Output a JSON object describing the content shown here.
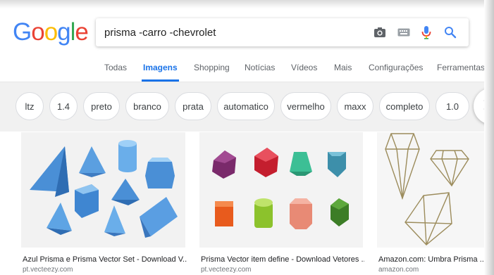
{
  "logo": {
    "letters": [
      "G",
      "o",
      "o",
      "g",
      "l",
      "e"
    ],
    "colors": [
      "#4285F4",
      "#EA4335",
      "#FBBC05",
      "#4285F4",
      "#34A853",
      "#EA4335"
    ]
  },
  "search": {
    "query": "prisma -carro -chevrolet",
    "icons": [
      "camera-icon",
      "keyboard-icon",
      "microphone-icon",
      "search-icon"
    ]
  },
  "tabs": [
    {
      "label": "Todas",
      "active": false
    },
    {
      "label": "Imagens",
      "active": true
    },
    {
      "label": "Shopping",
      "active": false
    },
    {
      "label": "Notícias",
      "active": false
    },
    {
      "label": "Vídeos",
      "active": false
    },
    {
      "label": "Mais",
      "active": false
    },
    {
      "label": "Configurações",
      "active": false
    },
    {
      "label": "Ferramentas",
      "active": false
    }
  ],
  "chips": [
    "ltz",
    "1.4",
    "preto",
    "branco",
    "prata",
    "automatico",
    "vermelho",
    "maxx",
    "completo",
    "1.0"
  ],
  "chips_next_icon": "chevron-right-icon",
  "results": [
    {
      "title": "Azul Prisma e Prisma Vector Set - Download V...",
      "source": "pt.vecteezy.com"
    },
    {
      "title": "Prisma Vector item define - Download Vetores ...",
      "source": "pt.vecteezy.com"
    },
    {
      "title": "Amazon.com: Umbra Prisma ...",
      "source": "amazon.com"
    }
  ],
  "colors": {
    "accent": "#1a73e8",
    "text_muted": "#5f6368",
    "chip_bg": "#f1f1f1"
  }
}
